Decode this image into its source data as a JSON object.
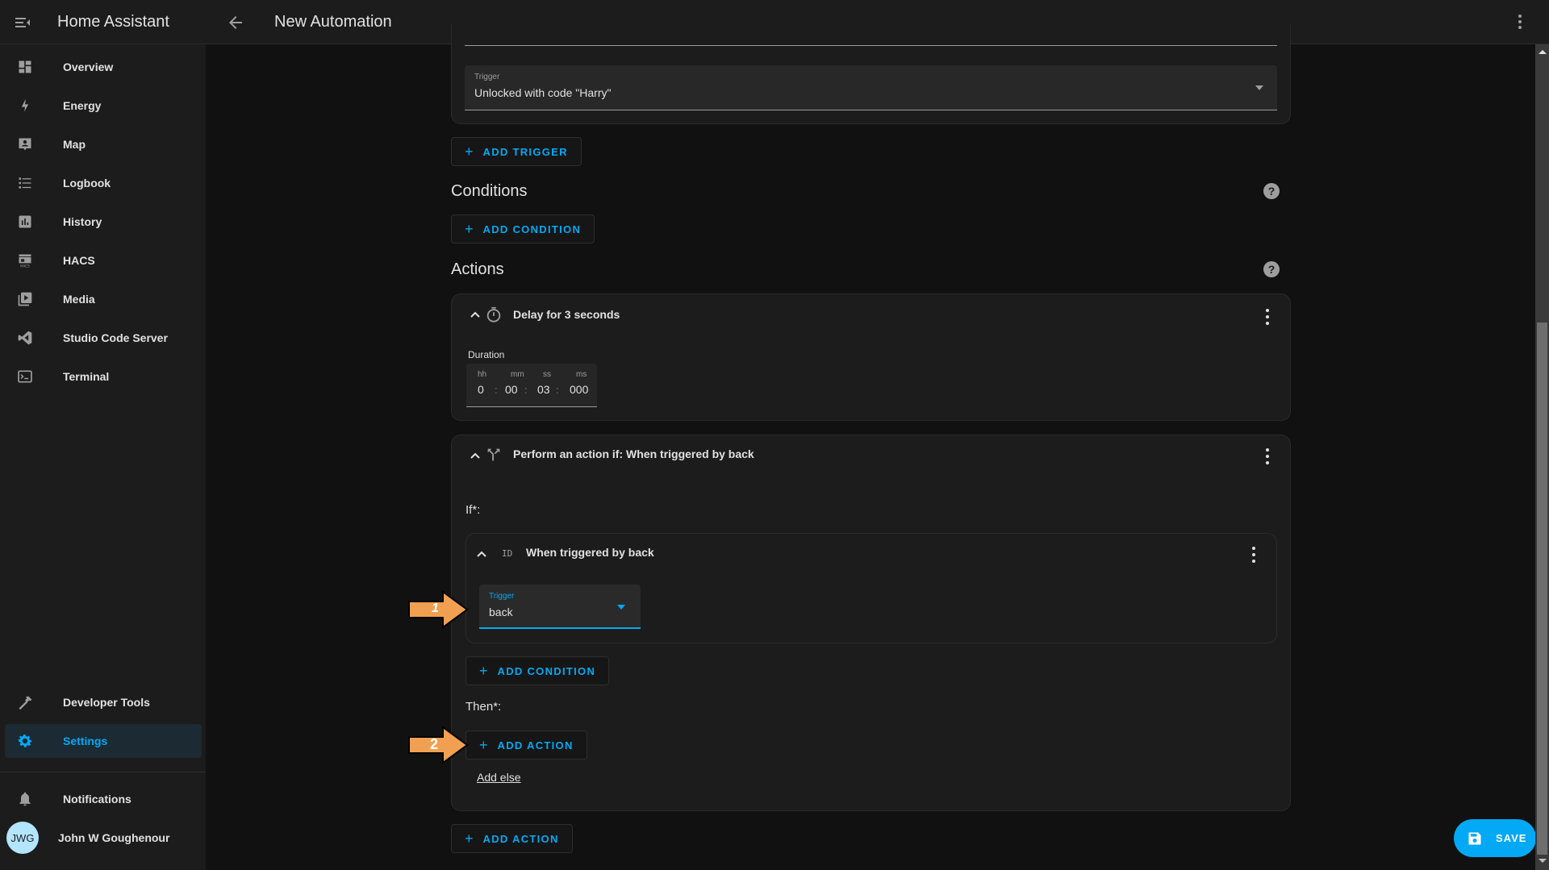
{
  "header": {
    "app_title": "Home Assistant",
    "page_title": "New Automation"
  },
  "sidebar": {
    "items": [
      {
        "label": "Overview",
        "icon": "view-dashboard-icon"
      },
      {
        "label": "Energy",
        "icon": "lightning-bolt-icon"
      },
      {
        "label": "Map",
        "icon": "account-box-icon"
      },
      {
        "label": "Logbook",
        "icon": "format-list-bulleted-icon"
      },
      {
        "label": "History",
        "icon": "chart-box-icon"
      },
      {
        "label": "HACS",
        "icon": "hacs-store-icon"
      },
      {
        "label": "Media",
        "icon": "play-box-multiple-icon"
      },
      {
        "label": "Studio Code Server",
        "icon": "vscode-icon"
      },
      {
        "label": "Terminal",
        "icon": "console-icon"
      }
    ],
    "developer_tools": "Developer Tools",
    "settings": "Settings",
    "notifications": "Notifications",
    "user_name": "John W Goughenour",
    "user_initials": "JWG"
  },
  "triggers": {
    "trigger_field_label": "Trigger",
    "trigger_field_value": "Unlocked with code \"Harry\"",
    "add_trigger": "ADD TRIGGER"
  },
  "conditions": {
    "title": "Conditions",
    "add_condition": "ADD CONDITION"
  },
  "actions": {
    "title": "Actions",
    "delay": {
      "title": "Delay for 3 seconds",
      "duration_label": "Duration",
      "hh_label": "hh",
      "hh": "0",
      "mm_label": "mm",
      "mm": "00",
      "ss_label": "ss",
      "ss": "03",
      "ms_label": "ms",
      "ms": "000",
      "sep": ":"
    },
    "choose": {
      "title": "Perform an action if: When triggered by back",
      "if_label": "If*:",
      "condition_title": "When triggered by back",
      "id_glyph": "ID",
      "trigger_label": "Trigger",
      "trigger_value": "back",
      "add_condition": "ADD CONDITION",
      "then_label": "Then*:",
      "add_action": "ADD ACTION",
      "add_else": "Add else"
    },
    "add_action": "ADD ACTION"
  },
  "annotations": {
    "arrow1": "1",
    "arrow2": "2"
  },
  "save_button": "SAVE",
  "plus": "+",
  "help": "?",
  "colors": {
    "accent": "#03a9f4",
    "arrow": "#f0a050",
    "avatar": "#b3e5fc"
  }
}
